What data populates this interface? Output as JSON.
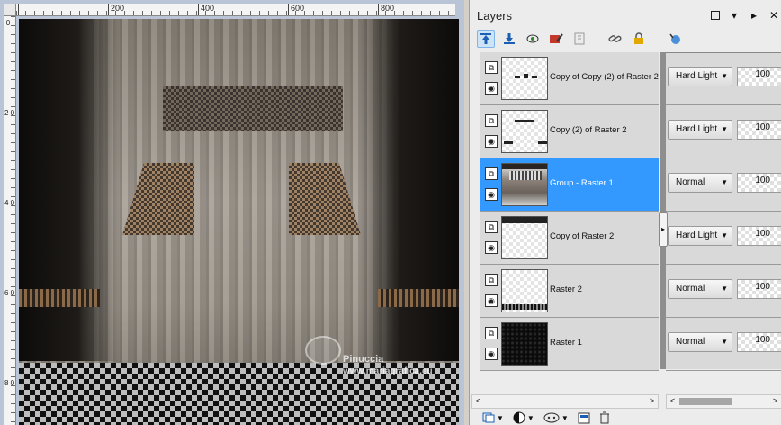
{
  "ruler": {
    "top_labels": [
      "200",
      "400",
      "600",
      "800"
    ],
    "left_labels": [
      "0",
      "2 0 0",
      "4 0 0",
      "6 0 0",
      "8 0 0"
    ]
  },
  "watermark": {
    "name": "Pinuccia",
    "url": "www.mariagrafica.eu"
  },
  "layers_panel": {
    "title": "Layers",
    "controls": [
      "restore-icon",
      "menu-down-icon",
      "pin-icon",
      "close-icon"
    ],
    "toolbar_icons": [
      "move-layer-up-icon",
      "move-layer-down-icon",
      "visibility-toggle-icon",
      "edit-icon",
      "lock-transparency-icon",
      "link-icon",
      "lock-icon",
      "reset-icon"
    ],
    "layers": [
      {
        "name": "Copy of Copy (2) of Raster 2",
        "blend_mode": "Hard Light",
        "opacity": "100",
        "selected": false
      },
      {
        "name": "Copy (2) of Raster 2",
        "blend_mode": "Hard Light",
        "opacity": "100",
        "selected": false
      },
      {
        "name": "Group - Raster 1",
        "blend_mode": "Normal",
        "opacity": "100",
        "selected": true
      },
      {
        "name": "Copy of Raster 2",
        "blend_mode": "Hard Light",
        "opacity": "100",
        "selected": false
      },
      {
        "name": "Raster 2",
        "blend_mode": "Normal",
        "opacity": "100",
        "selected": false
      },
      {
        "name": "Raster 1",
        "blend_mode": "Normal",
        "opacity": "100",
        "selected": false
      }
    ],
    "bottom_tools": [
      "new-layer-icon",
      "adjustment-layer-icon",
      "mask-icon",
      "group-icon",
      "delete-layer-icon"
    ],
    "colors": {
      "selected": "#3399ff",
      "row": "#d9d9d9"
    }
  }
}
